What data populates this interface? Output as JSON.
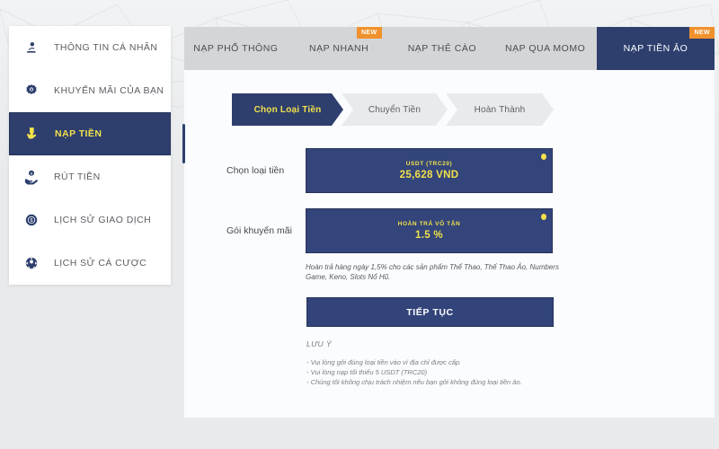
{
  "sidebar": {
    "items": [
      {
        "label": "THÔNG TIN CÁ NHÂN",
        "icon": "user-icon",
        "active": false
      },
      {
        "label": "KHUYẾN MÃI CỦA BẠN",
        "icon": "gift-badge-icon",
        "active": false
      },
      {
        "label": "NẠP TIỀN",
        "icon": "hand-click-icon",
        "active": true
      },
      {
        "label": "RÚT TIỀN",
        "icon": "hand-coin-icon",
        "active": false
      },
      {
        "label": "LỊCH SỬ GIAO DỊCH",
        "icon": "dollar-circle-icon",
        "active": false
      },
      {
        "label": "LỊCH SỬ CÁ CƯỢC",
        "icon": "soccer-ball-icon",
        "active": false
      }
    ]
  },
  "tabs": [
    {
      "label": "NẠP PHỔ THÔNG",
      "badge": "",
      "active": false
    },
    {
      "label": "NẠP NHANH",
      "badge": "NEW",
      "active": false
    },
    {
      "label": "NẠP THẺ CÀO",
      "badge": "",
      "active": false
    },
    {
      "label": "NẠP QUA MOMO",
      "badge": "",
      "active": false
    },
    {
      "label": "NẠP TIỀN ẢO",
      "badge": "NEW",
      "active": true
    }
  ],
  "stepper": [
    {
      "label": "Chọn Loại Tiền",
      "active": true
    },
    {
      "label": "Chuyển Tiền",
      "active": false
    },
    {
      "label": "Hoàn Thành",
      "active": false
    }
  ],
  "form": {
    "currency": {
      "label": "Chọn loại tiền",
      "value_top": "USDT (TRC20)",
      "value_main": "25,628 VND"
    },
    "promo": {
      "label": "Gói khuyến mãi",
      "value_top": "HOÀN TRẢ VÔ TẬN",
      "value_main": "1.5 %",
      "description": "Hoàn trả hàng ngày 1,5% cho các sản phẩm Thể Thao, Thể Thao Ảo, Numbers Game, Keno, Slots Nổ Hũ."
    },
    "continue_label": "TIẾP TỤC"
  },
  "notes": {
    "title": "LƯU Ý",
    "lines": [
      "- Vui lòng gởi đúng loại tiền vào ví địa chỉ được cấp.",
      "- Vui lòng nạp tối thiểu 5 USDT (TRC20)",
      "- Chúng tôi không chịu trách nhiệm nếu bạn gởi không đúng loại tiền ảo."
    ]
  },
  "colors": {
    "navy": "#2e3f6e",
    "navy_box": "#33457a",
    "yellow": "#f2e14a",
    "orange": "#f0912c",
    "tabbar_grey": "#d3d5d7",
    "page_bg": "#e8eaec"
  }
}
